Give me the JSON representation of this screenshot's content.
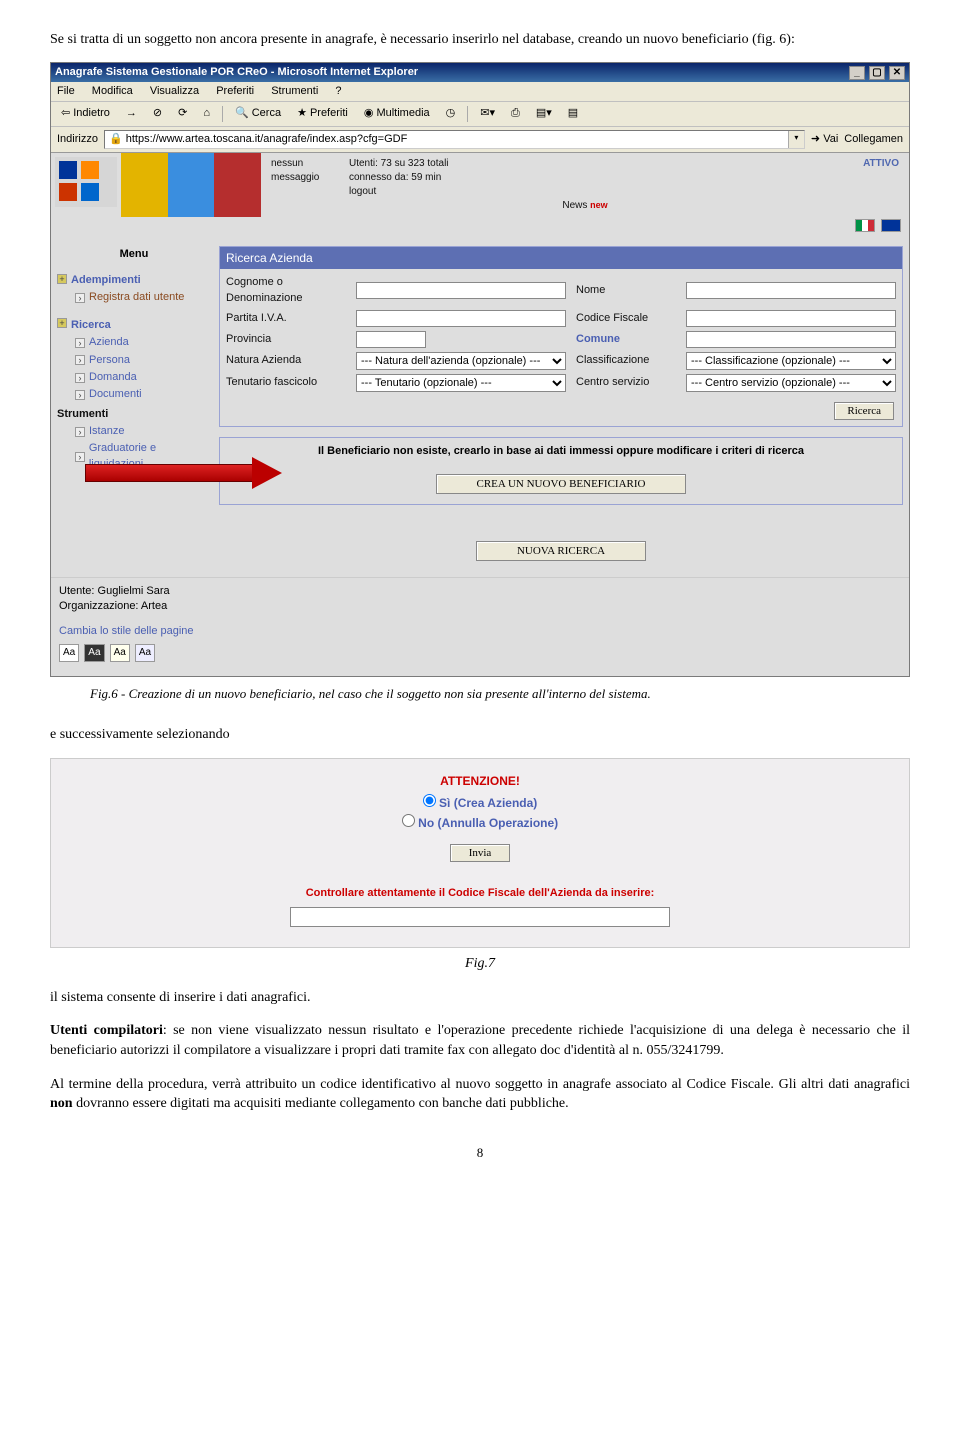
{
  "intro": "Se si tratta di un  soggetto non ancora presente in anagrafe, è necessario inserirlo nel database, creando un nuovo beneficiario (fig. 6):",
  "ie": {
    "title": "Anagrafe Sistema Gestionale POR CReO - Microsoft Internet Explorer",
    "menus": [
      "File",
      "Modifica",
      "Visualizza",
      "Preferiti",
      "Strumenti",
      "?"
    ],
    "back": "Indietro",
    "search": "Cerca",
    "fav": "Preferiti",
    "media": "Multimedia",
    "addr_label": "Indirizzo",
    "addr_value": "https://www.artea.toscana.it/anagrafe/index.asp?cfg=GDF",
    "go": "Vai",
    "links": "Collegamen"
  },
  "banner": {
    "msg_l1": "nessun",
    "msg_l2": "messaggio",
    "utenti": "Utenti: 73 su 323 totali",
    "conn": "connesso da: 59 min",
    "logout": "logout",
    "status": "ATTIVO",
    "news": "News"
  },
  "sidebar": {
    "menu": "Menu",
    "s1": "Adempimenti",
    "s1a": "Registra dati utente",
    "s2": "Ricerca",
    "s2a": "Azienda",
    "s2b": "Persona",
    "s2c": "Domanda",
    "s2d": "Documenti",
    "s3": "Strumenti",
    "s3a": "Istanze",
    "s3b": "Graduatorie e liquidazioni"
  },
  "form": {
    "header": "Ricerca Azienda",
    "cognome": "Cognome o Denominazione",
    "nome": "Nome",
    "piva": "Partita I.V.A.",
    "cf": "Codice Fiscale",
    "prov": "Provincia",
    "comune": "Comune",
    "natura": "Natura Azienda",
    "natura_opt": "--- Natura dell'azienda (opzionale) ---",
    "class": "Classificazione",
    "class_opt": "--- Classificazione (opzionale) ---",
    "tenut": "Tenutario fascicolo",
    "tenut_opt": "--- Tenutario (opzionale) ---",
    "centro": "Centro servizio",
    "centro_opt": "--- Centro servizio (opzionale) ---",
    "ricerca_btn": "Ricerca"
  },
  "msg": {
    "text": "Il Beneficiario non esiste, crearlo in base ai dati immessi oppure modificare i criteri di ricerca",
    "create_btn": "CREA UN NUOVO BENEFICIARIO",
    "new_search": "NUOVA RICERCA"
  },
  "utente": {
    "l1": "Utente: Guglielmi Sara",
    "l2": "Organizzazione: Artea",
    "style": "Cambia lo stile delle pagine"
  },
  "caption6": "Fig.6  - Creazione di un nuovo beneficiario, nel caso che il soggetto non sia presente all'interno del sistema.",
  "text_after6": "e successivamente selezionando",
  "fig7": {
    "att": "ATTENZIONE!",
    "yes": "Sì (Crea Azienda)",
    "no": "No (Annulla Operazione)",
    "invia": "Invia",
    "warn": "Controllare attentamente il Codice Fiscale dell'Azienda da inserire:"
  },
  "caption7": "Fig.7",
  "para1": " il sistema consente di inserire i dati anagrafici.",
  "para2a": "Utenti compilatori",
  "para2b": ": se non viene visualizzato nessun risultato e l'operazione precedente richiede l'acquisizione di una delega è necessario che il beneficiario autorizzi il compilatore a visualizzare i propri dati tramite fax con allegato doc d'identità al n. 055/3241799.",
  "para3a": "Al termine della procedura, verrà attribuito un codice identificativo al nuovo soggetto in anagrafe associato al Codice Fiscale. Gli altri dati anagrafici ",
  "para3b": "non",
  "para3c": " dovranno essere digitati ma acquisiti mediante collegamento con banche dati pubbliche.",
  "page": "8"
}
